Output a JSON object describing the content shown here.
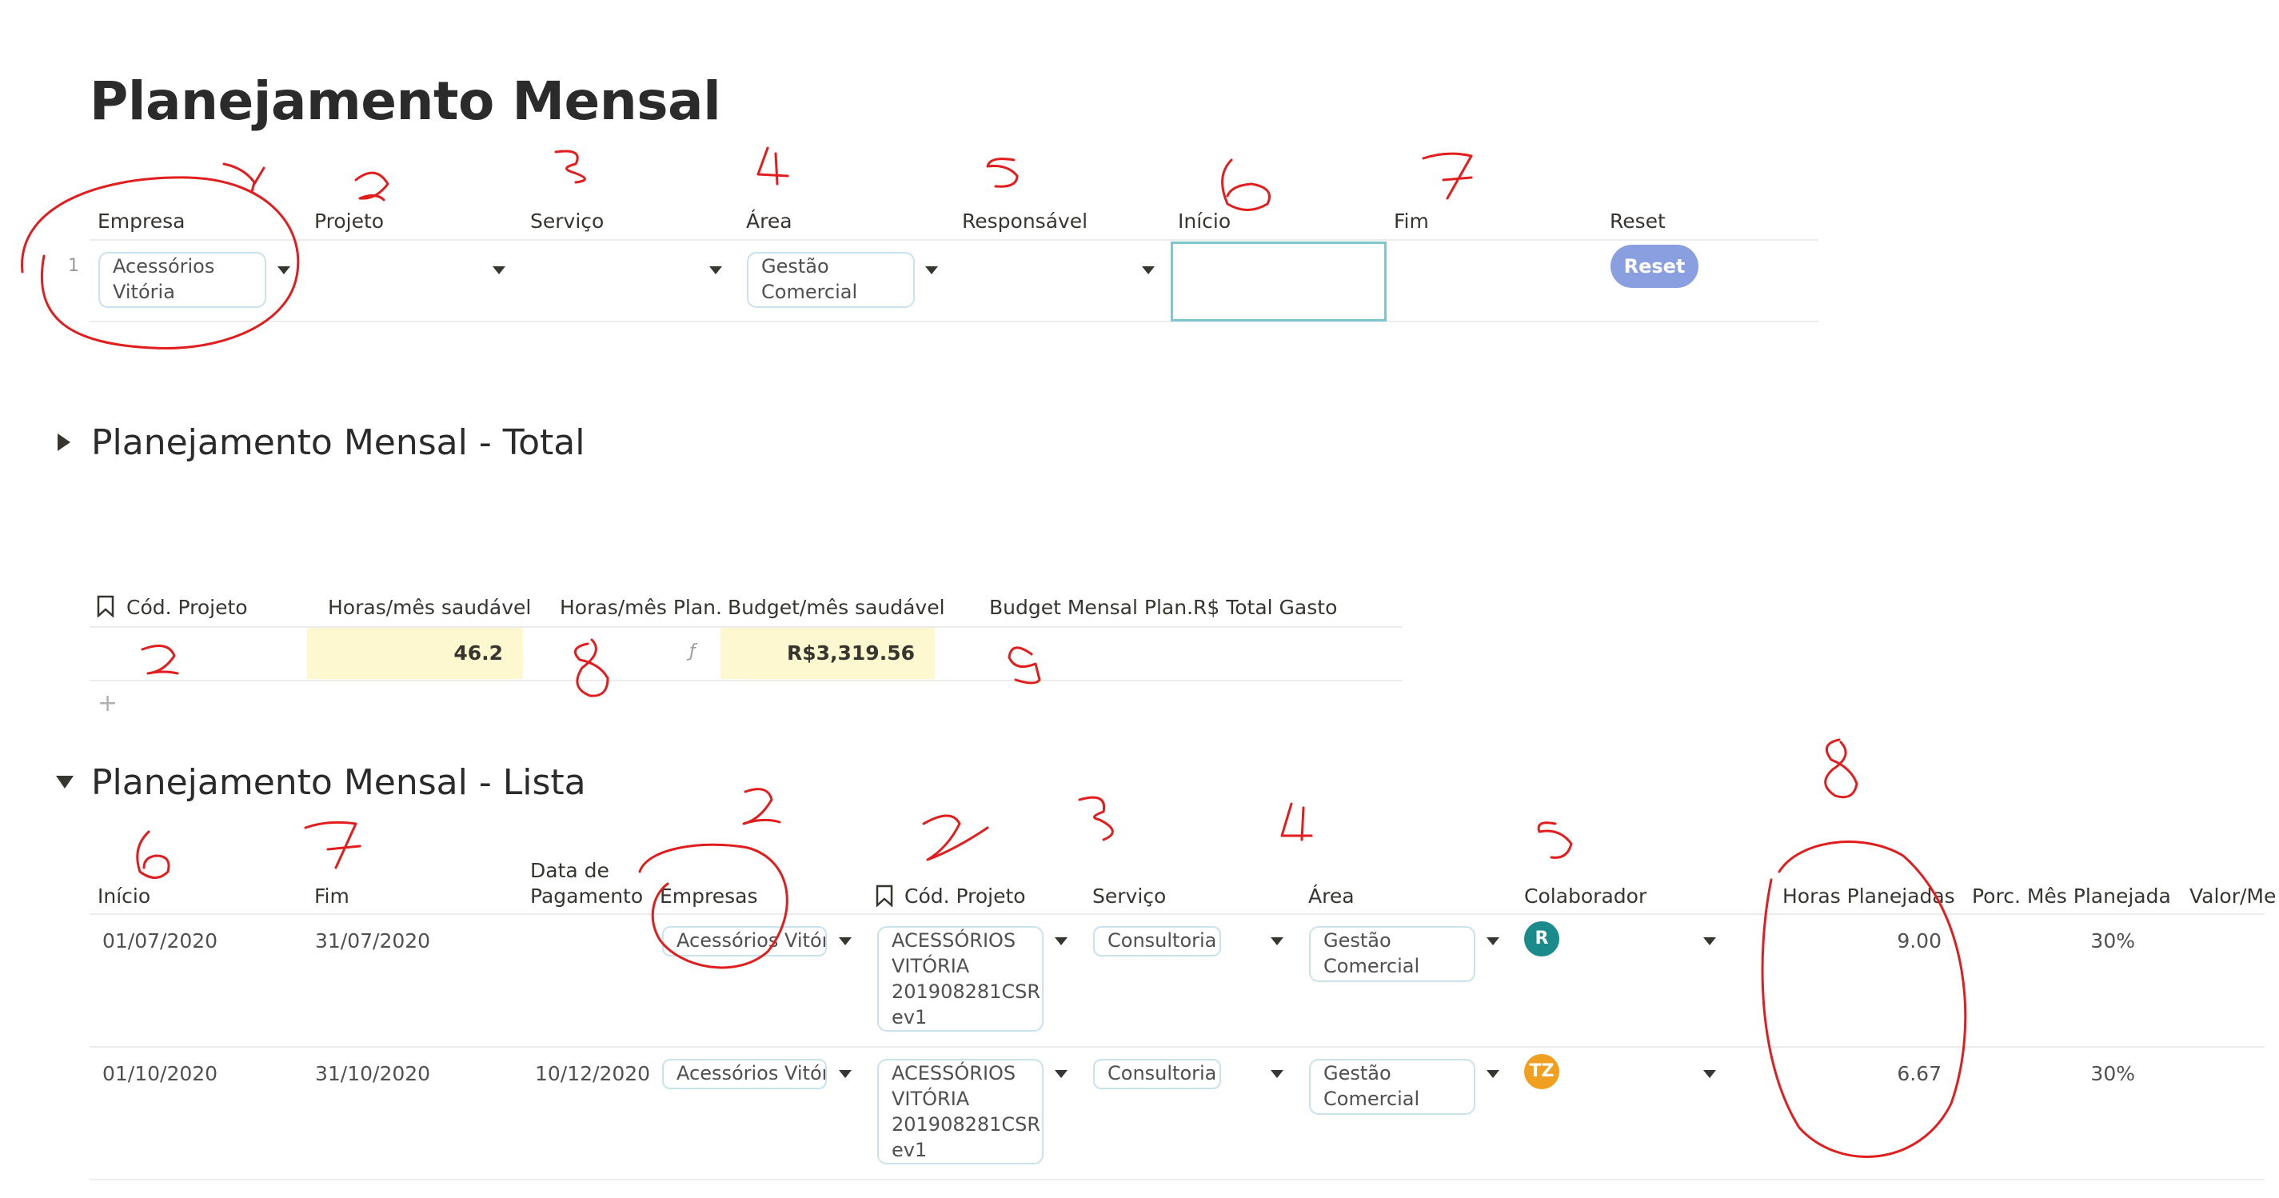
{
  "page": {
    "title": "Planejamento Mensal"
  },
  "filters": {
    "headers": [
      "Empresa",
      "Projeto",
      "Serviço",
      "Área",
      "Responsável",
      "Início",
      "Fim",
      "Reset"
    ],
    "row_number": "1",
    "empresa": "Acessórios Vitória",
    "area": "Gestão Comercial",
    "reset_label": "Reset"
  },
  "total_section": {
    "title": "Planejamento Mensal - Total",
    "headers": [
      "Cód. Projeto",
      "Horas/mês saudável",
      "Horas/mês Plan.",
      "Budget/mês saudável",
      "Budget Mensal Plan.",
      "R$ Total Gasto"
    ],
    "horas_saudavel": "46.2",
    "formula_icon": "ƒ",
    "budget_saudavel": "R$3,319.56",
    "add_label": "+"
  },
  "list_section": {
    "title": "Planejamento Mensal - Lista",
    "headers": {
      "inicio": "Início",
      "fim": "Fim",
      "data_pag_1": "Data de",
      "data_pag_2": "Pagamento",
      "empresas": "Empresas",
      "cod": "Cód. Projeto",
      "servico": "Serviço",
      "area": "Área",
      "colaborador": "Colaborador",
      "horas": "Horas Planejadas",
      "porc": "Porc. Mês Planejada",
      "valor": "Valor/Me"
    },
    "rows": [
      {
        "inicio": "01/07/2020",
        "fim": "31/07/2020",
        "data_pagamento": "",
        "empresa": "Acessórios Vitória",
        "cod_projeto": "ACESSÓRIOS VITÓRIA 201908281CSR ev1",
        "servico": "Consultoria",
        "area": "Gestão Comercial",
        "colaborador_initials": "R",
        "colaborador_color": "#1a8a8a",
        "horas": "9.00",
        "porc": "30%"
      },
      {
        "inicio": "01/10/2020",
        "fim": "31/10/2020",
        "data_pagamento": "10/12/2020",
        "empresa": "Acessórios Vitória",
        "cod_projeto": "ACESSÓRIOS VITÓRIA 201908281CSR ev1",
        "servico": "Consultoria",
        "area": "Gestão Comercial",
        "colaborador_initials": "TZ",
        "colaborador_color": "#f0a020",
        "horas": "6.67",
        "porc": "30%"
      }
    ]
  },
  "annotation_color": "#e21d1d"
}
